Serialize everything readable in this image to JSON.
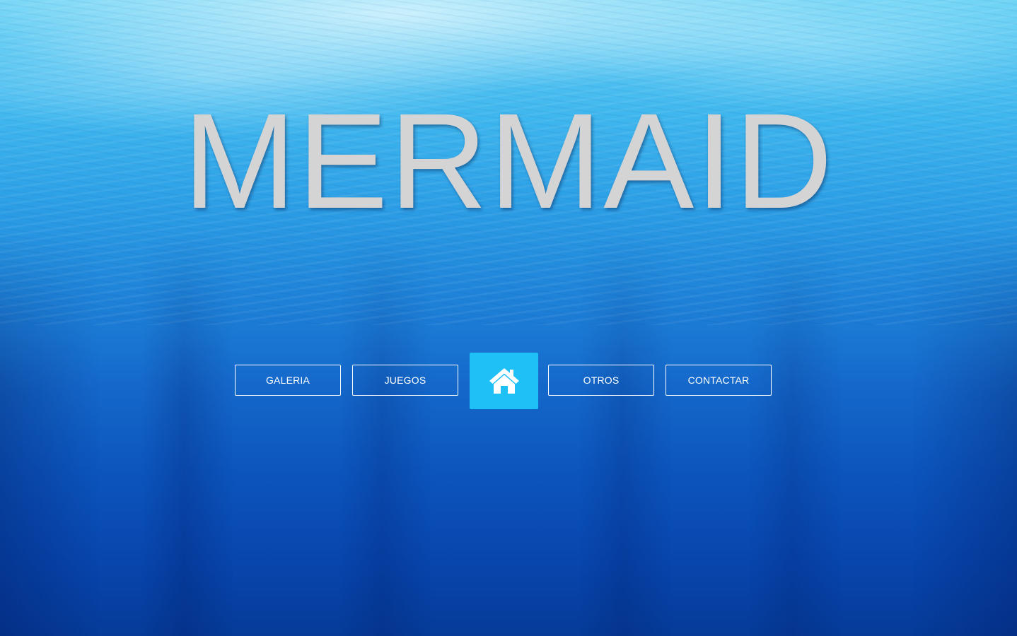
{
  "header": {
    "title": "MERMAID"
  },
  "nav": {
    "items": [
      {
        "label": "GALERIA"
      },
      {
        "label": "JUEGOS"
      },
      {
        "label": "OTROS"
      },
      {
        "label": "CONTACTAR"
      }
    ],
    "home_icon": "home-icon"
  },
  "colors": {
    "title": "#d4d4d4",
    "home_button": "#1ec0f5",
    "button_border": "#ffffff",
    "background_top": "#6fd4f5",
    "background_bottom": "#063b99"
  }
}
